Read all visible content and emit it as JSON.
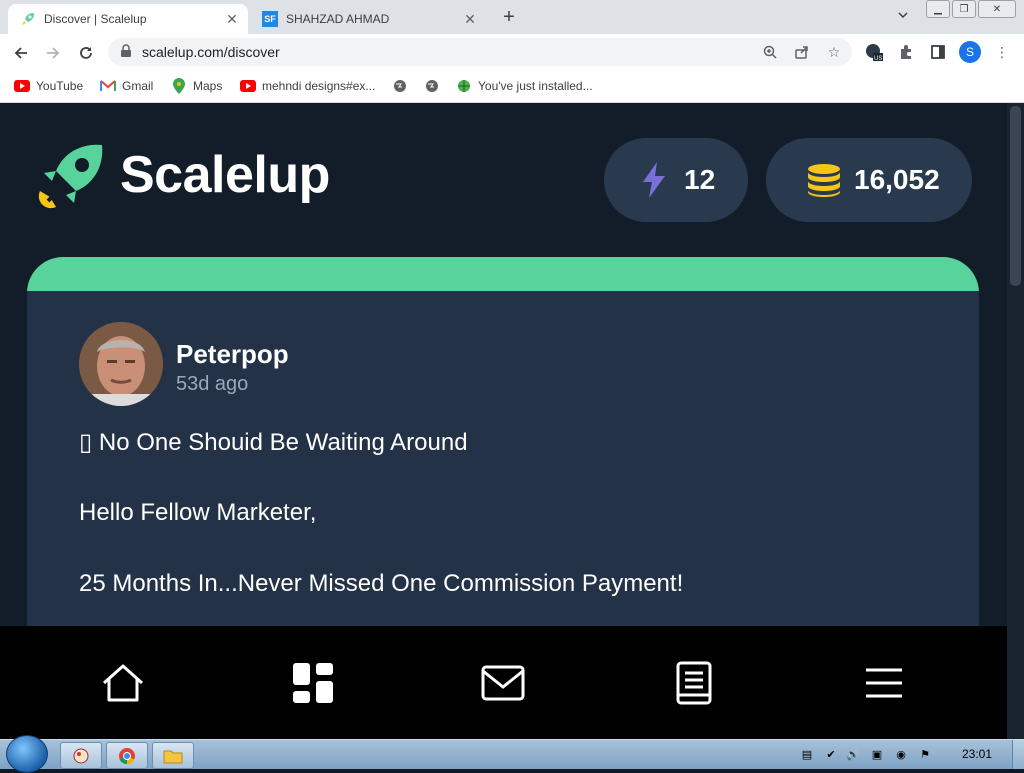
{
  "browser": {
    "tabs": [
      {
        "title": "Discover | Scalelup",
        "active": true,
        "favicon": "rocket-icon"
      },
      {
        "title": "SHAHZAD AHMAD",
        "active": false,
        "favicon": "SF"
      }
    ],
    "url": "scalelup.com/discover",
    "profile_initial": "S",
    "bookmarks": [
      {
        "label": "YouTube",
        "icon": "youtube-icon"
      },
      {
        "label": "Gmail",
        "icon": "gmail-icon"
      },
      {
        "label": "Maps",
        "icon": "maps-icon"
      },
      {
        "label": "mehndi designs#ex...",
        "icon": "youtube-icon"
      },
      {
        "label": "",
        "icon": "globe-icon"
      },
      {
        "label": "",
        "icon": "globe-icon"
      },
      {
        "label": "You've just installed...",
        "icon": "globe-icon"
      }
    ]
  },
  "app": {
    "brand": "Scalelup",
    "energy": "12",
    "coins": "16,052",
    "accent": "#57d39b",
    "energy_color": "#7b6fd8",
    "coin_color": "#f5c518"
  },
  "post": {
    "author": "Peterpop",
    "ago": "53d ago",
    "lines": [
      "▯ No One Shouid Be Waiting Around",
      "Hello Fellow Marketer,",
      "25 Months In...Never Missed One Commission Payment!"
    ]
  },
  "bottom_nav": [
    "home-icon",
    "dashboard-icon",
    "mail-icon",
    "book-icon",
    "menu-icon"
  ],
  "taskbar": {
    "time": "23:01"
  }
}
